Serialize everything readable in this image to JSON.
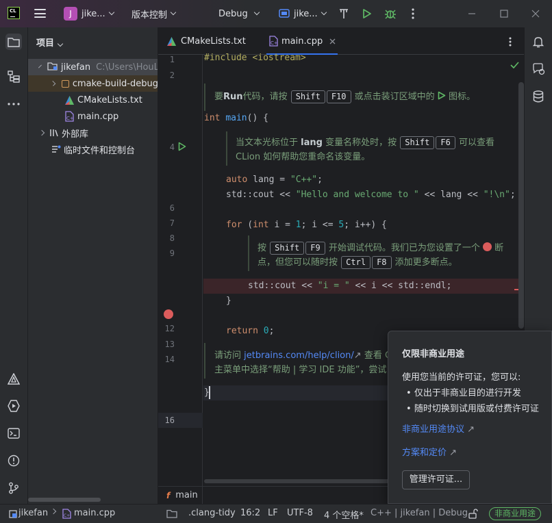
{
  "titlebar": {
    "project_badge": "J",
    "project_name": "jike...",
    "vcs_label": "版本控制",
    "config_label": "Debug",
    "target_label": "jike..."
  },
  "project_panel": {
    "title": "项目",
    "rows": [
      {
        "label": "jikefan",
        "path": "C:\\Users\\HouLe"
      },
      {
        "label": "cmake-build-debug"
      },
      {
        "label": "CMakeLists.txt"
      },
      {
        "label": "main.cpp"
      },
      {
        "label": "外部库"
      },
      {
        "label": "临时文件和控制台"
      }
    ]
  },
  "tabs": [
    {
      "label": "CMakeLists.txt"
    },
    {
      "label": "main.cpp"
    }
  ],
  "editor": {
    "line_numbers": [
      "1",
      "2",
      "4",
      "6",
      "7",
      "8",
      "9",
      "12",
      "13",
      "14",
      "16"
    ],
    "code": {
      "l1": "#include <iostream>",
      "l4_kw": "int",
      "l4_fn": "main",
      "l4_rest": "() {",
      "l6_kw": "auto",
      "l6_a": " lang = ",
      "l6_str": "\"C++\"",
      "l6_b": ";",
      "l7_a": "std::cout << ",
      "l7_str": "\"Hello and welcome to \"",
      "l7_b": " << lang << ",
      "l7_str2": "\"!\\n\"",
      "l7_c": ";",
      "l9_kw": "for",
      "l9_a": " (",
      "l9_kw2": "int",
      "l9_b": " i = ",
      "l9_n1": "1",
      "l9_c": "; i <= ",
      "l9_n2": "5",
      "l9_d": "; i++) {",
      "l11_a": "std::cout << ",
      "l11_str": "\"i = \"",
      "l11_b": " << i << std::endl;",
      "l12": "}",
      "l14_kw": "return",
      "l14_n": "0",
      "l14_rest": ";",
      "l16": "}"
    },
    "tip1": {
      "a": "要",
      "b": "Run",
      "c": "代码，请按",
      "k1": "Shift",
      "k2": "F10",
      "d": "或点击装订区域中的",
      "e": "图标。"
    },
    "tip2": {
      "a": "当文本光标位于",
      "b": "lang",
      "c": "变量名称处时，按",
      "k1": "Shift",
      "k2": "F6",
      "d": "可以查看",
      "e": "CLion 如何帮助您重命名该变量。"
    },
    "tip3": {
      "a": "按",
      "k1": "Shift",
      "k2": "F9",
      "b": "开始调试代码。我们已为您设置了一个",
      "c": "断",
      "d": "点，但您可以随时按",
      "k3": "Ctrl",
      "k4": "F8",
      "e": "添加更多断点。"
    },
    "tip4": {
      "a": "请访问",
      "link": "jetbrains.com/help/clion/",
      "b": "查看 C",
      "c": "主菜单中选择“帮助 | 学习 IDE 功能”，尝试 C"
    },
    "breadcrumb": "main"
  },
  "popup": {
    "title": "仅限非商业用途",
    "text": "使用您当前的许可证，您可以:",
    "bullets": [
      "仅出于非商业目的进行开发",
      "随时切换到试用版或付费许可证"
    ],
    "link1": "非商业用途协议",
    "link2": "方案和定价",
    "button": "管理许可证..."
  },
  "statusbar": {
    "crumb1": "jikefan",
    "crumb2": "main.cpp",
    "clang_tidy": ".clang-tidy",
    "position": "16:2",
    "line_ending": "LF",
    "encoding": "UTF-8",
    "indent": "4 个空格*",
    "context": "C++ | jikefan | Debug",
    "license_badge": "非商业用途"
  },
  "colors": {
    "accent": "#3574f0",
    "run_green": "#5fb865",
    "breakpoint": "#db5c5c",
    "link": "#548af7"
  }
}
